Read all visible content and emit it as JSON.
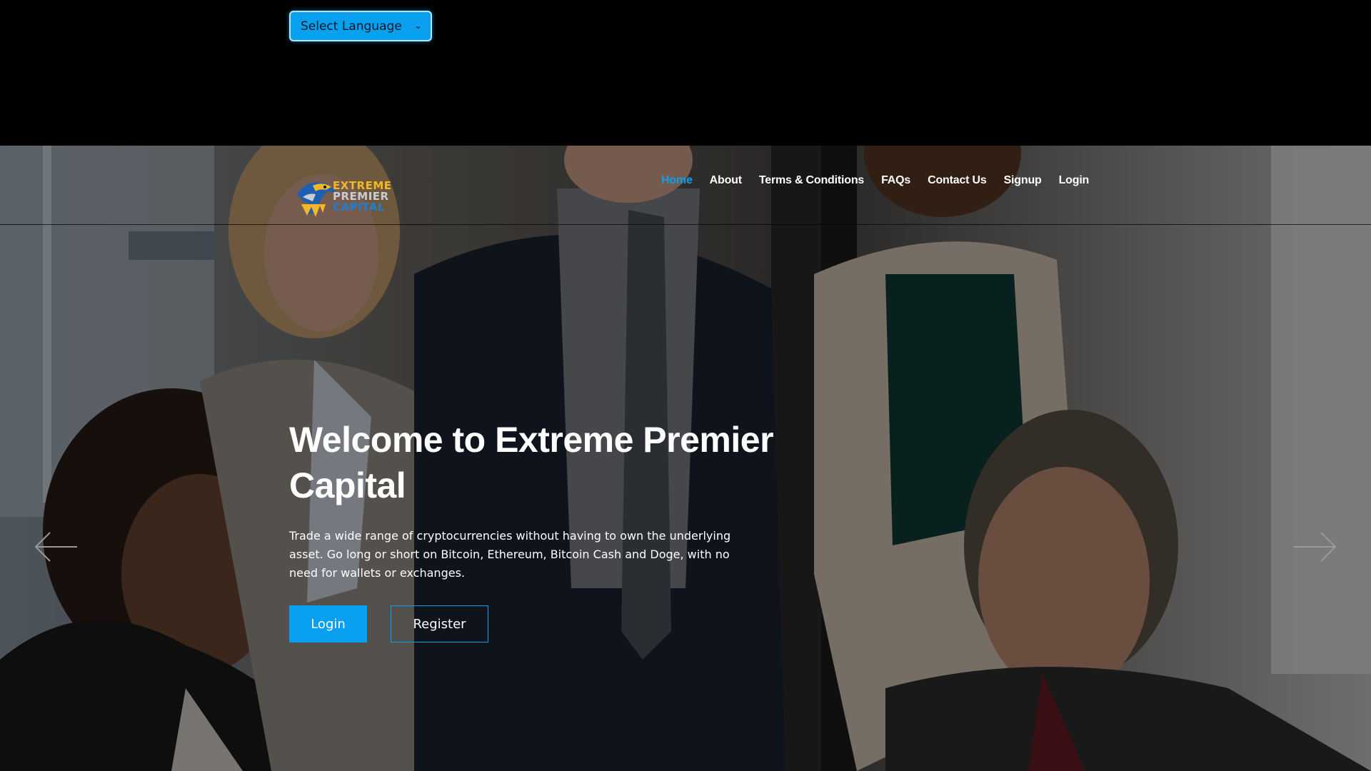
{
  "language_select": {
    "value": "Select Language"
  },
  "brand": {
    "logo_line1": "EXTREME",
    "logo_line2": "PREMIER",
    "logo_line3": "CAPITAL",
    "logo_icon": "eagle-icon",
    "accent_color": "#0aa0f0"
  },
  "nav": {
    "items": [
      {
        "label": "Home",
        "active": true
      },
      {
        "label": "About"
      },
      {
        "label": "Terms & Conditions"
      },
      {
        "label": "FAQs"
      },
      {
        "label": "Contact Us"
      },
      {
        "label": "Signup"
      },
      {
        "label": "Login"
      }
    ]
  },
  "hero": {
    "title": "Welcome to Extreme Premier Capital",
    "subtitle": "Trade a wide range of cryptocurrencies without having to own the underlying asset. Go long or short on Bitcoin, Ethereum, Bitcoin Cash and Doge, with no need for wallets or exchanges.",
    "login_button": "Login",
    "register_button": "Register",
    "prev_icon": "arrow-left-icon",
    "next_icon": "arrow-right-icon"
  }
}
